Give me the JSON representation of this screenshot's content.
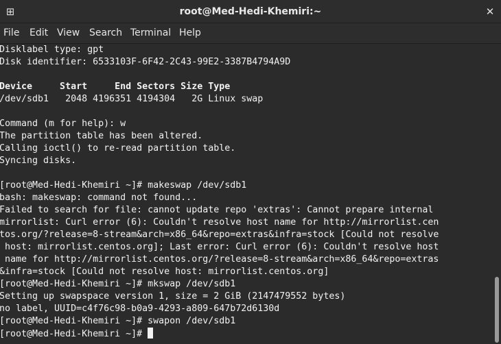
{
  "window": {
    "title": "root@Med-Hedi-Khemiri:~",
    "new_tab_glyph": "⊞",
    "close_glyph": "✕"
  },
  "menu": [
    "File",
    "Edit",
    "View",
    "Search",
    "Terminal",
    "Help"
  ],
  "terminal": {
    "lines": [
      "Disklabel type: gpt",
      "Disk identifier: 6533103F-6F42-2C43-99E2-3387B4794A9D",
      "",
      "Device     Start     End Sectors Size Type",
      "/dev/sdb1   2048 4196351 4194304   2G Linux swap",
      "",
      "Command (m for help): w",
      "The partition table has been altered.",
      "Calling ioctl() to re-read partition table.",
      "Syncing disks.",
      "",
      "[root@Med-Hedi-Khemiri ~]# makeswap /dev/sdb1",
      "bash: makeswap: command not found...",
      "Failed to search for file: cannot update repo 'extras': Cannot prepare internal",
      "mirrorlist: Curl error (6): Couldn't resolve host name for http://mirrorlist.cen",
      "tos.org/?release=8-stream&arch=x86_64&repo=extras&infra=stock [Could not resolve",
      " host: mirrorlist.centos.org]; Last error: Curl error (6): Couldn't resolve host",
      " name for http://mirrorlist.centos.org/?release=8-stream&arch=x86_64&repo=extras",
      "&infra=stock [Could not resolve host: mirrorlist.centos.org]",
      "[root@Med-Hedi-Khemiri ~]# mkswap /dev/sdb1",
      "Setting up swapspace version 1, size = 2 GiB (2147479552 bytes)",
      "no label, UUID=c4f76c98-b0a9-4293-a809-647b72d6130d",
      "[root@Med-Hedi-Khemiri ~]# swapon /dev/sdb1",
      "[root@Med-Hedi-Khemiri ~]# "
    ],
    "bold_line_index": 3,
    "scroll_position": 1.0,
    "visible_fraction": 0.22
  },
  "colors": {
    "background": "#2b2b2b",
    "foreground": "#f2f2f2",
    "scrollbar_thumb": "#9a9a9a"
  }
}
